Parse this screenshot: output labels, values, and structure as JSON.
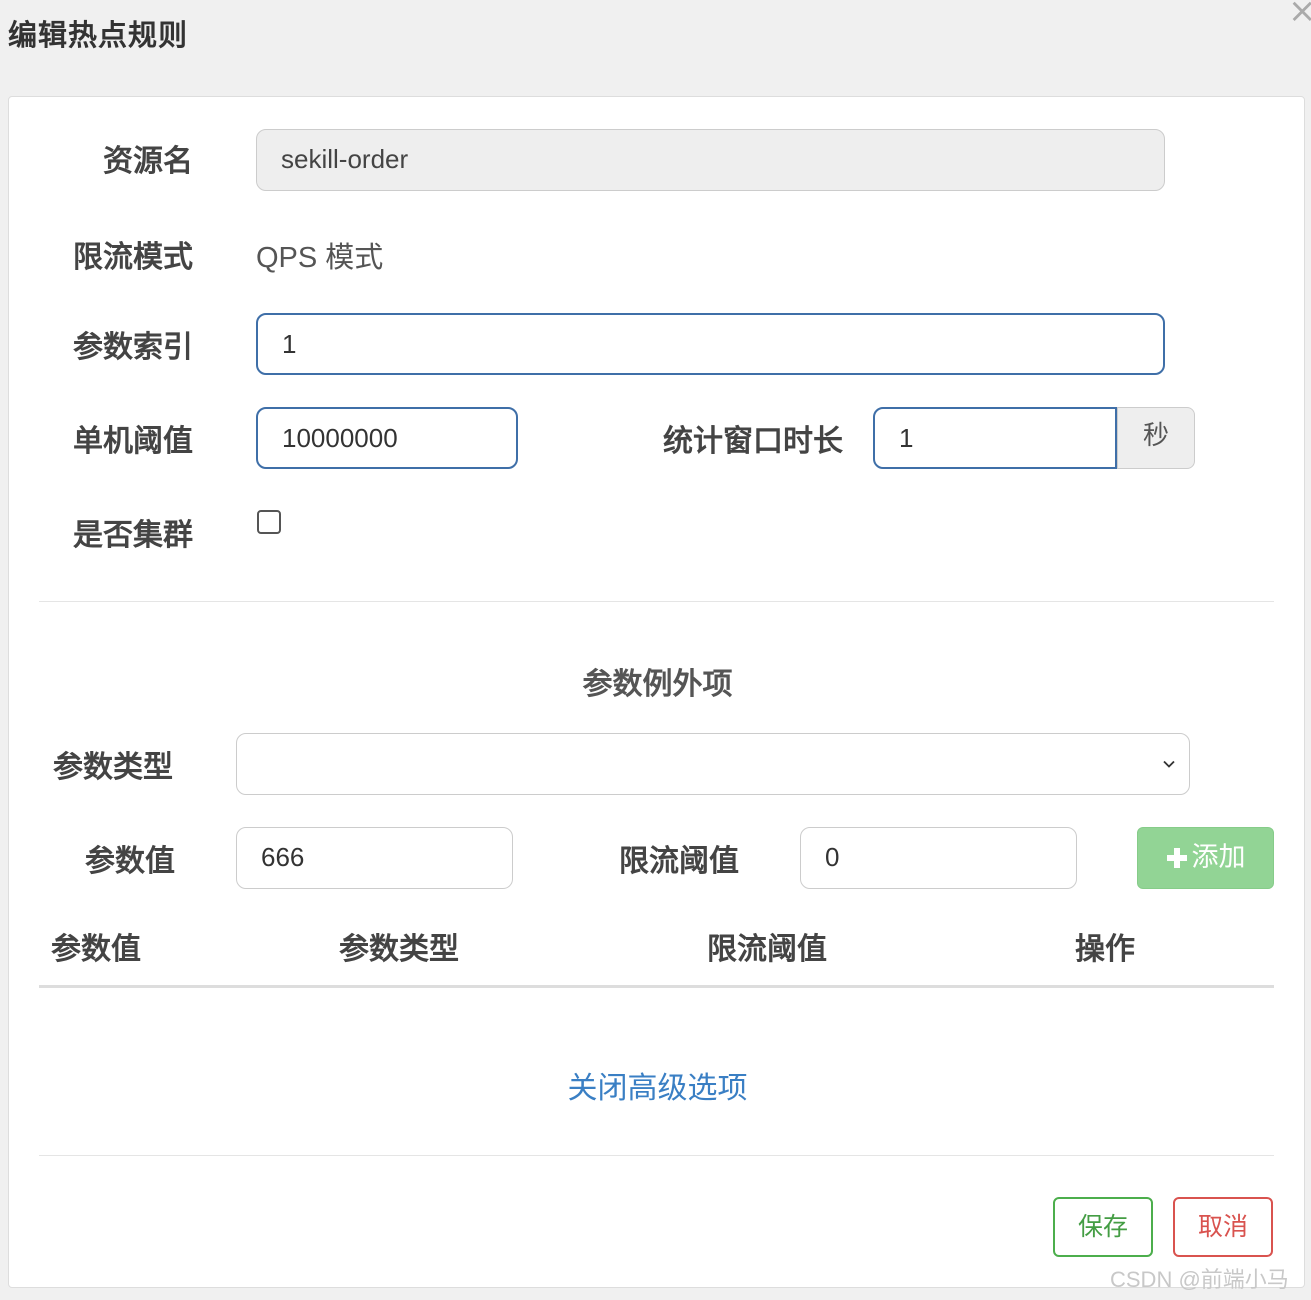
{
  "dialog": {
    "title": "编辑热点规则",
    "close_label": "×"
  },
  "form": {
    "resource": {
      "label": "资源名",
      "value": "sekill-order"
    },
    "mode": {
      "label": "限流模式",
      "value": "QPS 模式"
    },
    "param_index": {
      "label": "参数索引",
      "value": "1"
    },
    "threshold": {
      "label": "单机阈值",
      "value": "10000000"
    },
    "window": {
      "label": "统计窗口时长",
      "value": "1",
      "unit": "秒"
    },
    "cluster": {
      "label": "是否集群",
      "checked": false
    }
  },
  "exceptions": {
    "title": "参数例外项",
    "param_type": {
      "label": "参数类型",
      "selected": ""
    },
    "param_value": {
      "label": "参数值",
      "value": "666"
    },
    "limit": {
      "label": "限流阈值",
      "value": "0"
    },
    "add_button": {
      "icon": "plus-icon",
      "label": "添加"
    },
    "table_headers": [
      "参数值",
      "参数类型",
      "限流阈值",
      "操作"
    ]
  },
  "advanced_link": "关闭高级选项",
  "footer": {
    "save_label": "保存",
    "cancel_label": "取消"
  },
  "watermark": "CSDN @前端小马",
  "colors": {
    "focus_border": "#3f6fa8",
    "add_button": "#92d495",
    "link": "#3a7fc4",
    "save": "#449d44",
    "cancel": "#d9534f"
  }
}
